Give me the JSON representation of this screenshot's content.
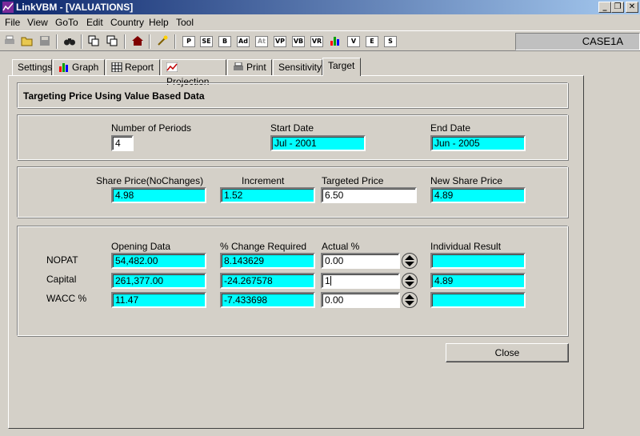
{
  "window": {
    "title": "LinkVBM - [VALUATIONS]"
  },
  "menu": [
    {
      "label": "File"
    },
    {
      "label": "View"
    },
    {
      "label": "GoTo"
    },
    {
      "label": "Edit"
    },
    {
      "label": "Country"
    },
    {
      "label": "Help"
    },
    {
      "label": "Tool"
    }
  ],
  "toolbar": {
    "buttons": [
      "P",
      "SE",
      "B",
      "Ad",
      "At",
      "VP",
      "VB",
      "VR",
      "V",
      "E",
      "S"
    ],
    "case_name": "CASE1A"
  },
  "tabs": [
    "Settings",
    "Graph",
    "Report",
    "Projection",
    "Print",
    "Sensitivity",
    "Target"
  ],
  "active_tab": "Target",
  "heading": "Targeting Price Using Value Based Data",
  "periods": {
    "num_periods_label": "Number of Periods",
    "num_periods_value": "4",
    "start_date_label": "Start Date",
    "start_date_value": "Jul - 2001",
    "end_date_label": "End Date",
    "end_date_value": "Jun - 2005"
  },
  "price": {
    "share_price_label": "Share Price(NoChanges)",
    "share_price_value": "4.98",
    "increment_label": "Increment",
    "increment_value": "1.52",
    "targeted_price_label": "Targeted Price",
    "targeted_price_value": "6.50",
    "new_share_price_label": "New Share Price",
    "new_share_price_value": "4.89"
  },
  "drivers": {
    "headers": {
      "opening": "Opening Data",
      "change": "% Change Required",
      "actual": "Actual %",
      "result": "Individual Result"
    },
    "rows": [
      {
        "label": "NOPAT",
        "opening": "54,482.00",
        "change": "8.143629",
        "actual": "0.00",
        "result": ""
      },
      {
        "label": "Capital",
        "opening": "261,377.00",
        "change": "-24.267578",
        "actual": "1",
        "result": "4.89"
      },
      {
        "label": "WACC %",
        "opening": "11.47",
        "change": "-7.433698",
        "actual": "0.00",
        "result": ""
      }
    ]
  },
  "close_label": "Close",
  "colors": {
    "title_bar": "#0a246a",
    "field_highlight": "#00ffff",
    "face": "#d4d0c8"
  }
}
